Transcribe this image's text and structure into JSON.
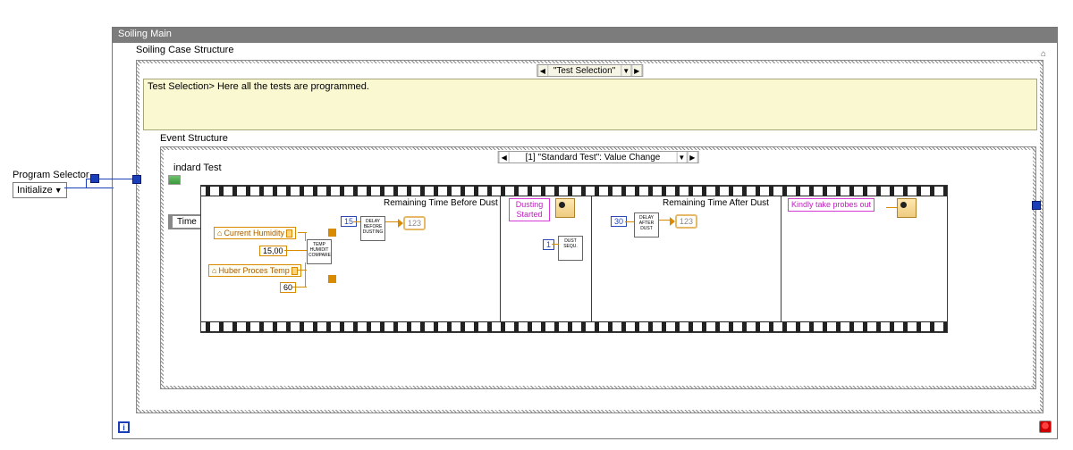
{
  "program_selector": {
    "label": "Program Selector",
    "value": "Initialize"
  },
  "window": {
    "title": "Soiling Main"
  },
  "case_structure": {
    "label": "Soiling Case Structure",
    "selected": "\"Test Selection\"",
    "comment": "Test Selection> Here all the tests are programmed."
  },
  "event_structure": {
    "label": "Event Structure",
    "selected": "[1] \"Standard Test\": Value Change",
    "sublabel": "indard Test",
    "time_terminal": "Time"
  },
  "pane1": {
    "prop_humidity": "Current Humidity",
    "prop_temp": "Huber Proces Temp",
    "const_humidity": "15,00",
    "const_temp": "60",
    "subvi": "TEMP HUMIDIT COMPARE",
    "const_delay": "15",
    "subvi_delay": "DELAY BEFORE DUSTING",
    "indicator_label": "Remaining Time Before Dust",
    "indicator_value": "123"
  },
  "pane2": {
    "dialog_label": "Dusting Started",
    "const_seq": "1",
    "subvi_seq": "DUST SEQU."
  },
  "pane3": {
    "const_delay": "30",
    "subvi_delay": "DELAY AFTER DUST",
    "indicator_label": "Remaining Time After Dust",
    "indicator_value": "123"
  },
  "pane4": {
    "dialog_label": "Kindly take probes out"
  },
  "info_glyph": "i"
}
